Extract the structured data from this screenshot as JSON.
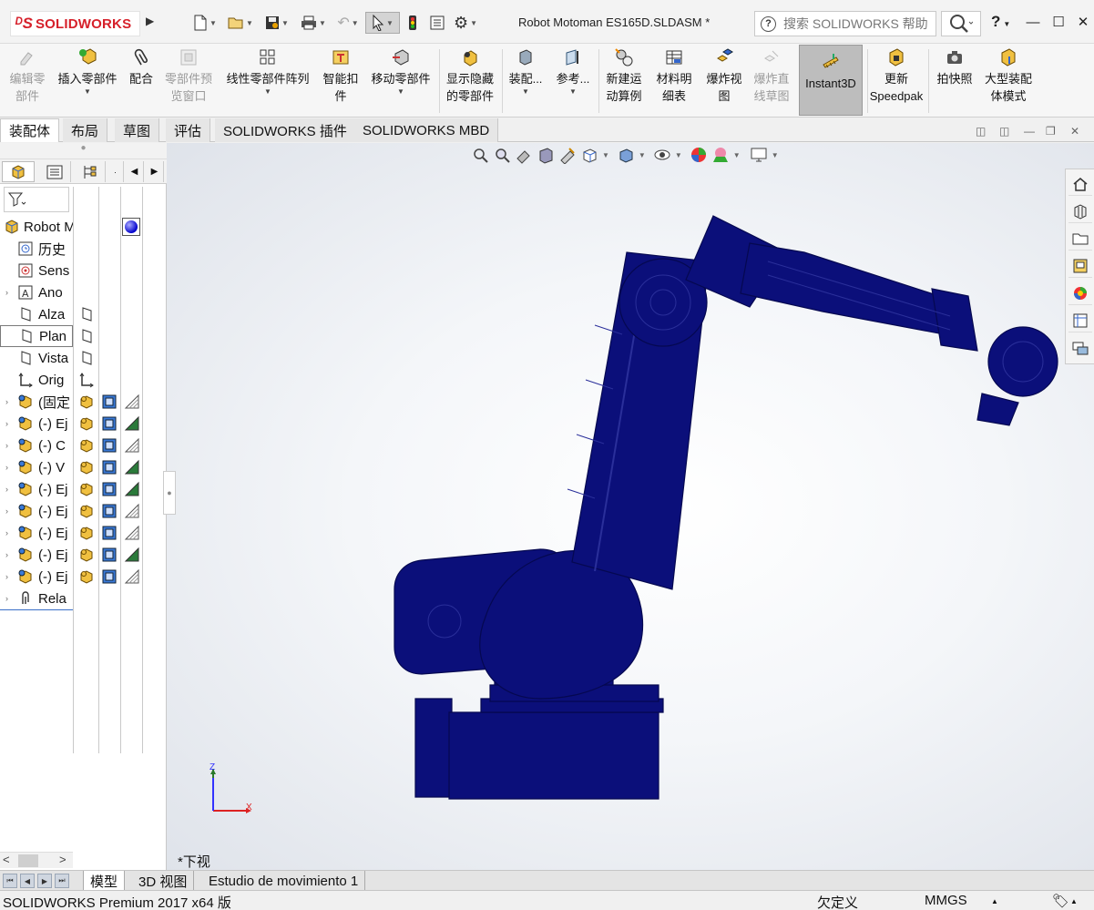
{
  "app": {
    "logo_text": "SOLIDWORKS",
    "document_title": "Robot Motoman ES165D.SLDASM *",
    "search_placeholder": "搜索 SOLIDWORKS 帮助",
    "help_label": "?"
  },
  "command_manager": {
    "items": [
      {
        "label": "编辑零\n部件",
        "enabled": false,
        "icon": "edit-component-icon"
      },
      {
        "label": "插入零部件",
        "enabled": true,
        "icon": "insert-components-icon",
        "dropdown": true
      },
      {
        "label": "配合",
        "enabled": true,
        "icon": "mate-icon"
      },
      {
        "label": "零部件预\n览窗口",
        "enabled": false,
        "icon": "component-preview-icon"
      },
      {
        "label": "线性零部件阵列",
        "enabled": true,
        "icon": "linear-pattern-icon",
        "dropdown": true
      },
      {
        "label": "智能扣\n件",
        "enabled": true,
        "icon": "smart-fasteners-icon"
      },
      {
        "label": "移动零部件",
        "enabled": true,
        "icon": "move-component-icon",
        "dropdown": true
      },
      {
        "label": "显示隐藏\n的零部件",
        "enabled": true,
        "icon": "show-hidden-icon"
      },
      {
        "label": "装配...",
        "enabled": true,
        "icon": "assembly-features-icon",
        "dropdown": true
      },
      {
        "label": "参考...",
        "enabled": true,
        "icon": "reference-geometry-icon",
        "dropdown": true
      },
      {
        "label": "新建运\n动算例",
        "enabled": true,
        "icon": "new-motion-study-icon"
      },
      {
        "label": "材料明\n细表",
        "enabled": true,
        "icon": "bom-icon"
      },
      {
        "label": "爆炸视\n图",
        "enabled": true,
        "icon": "exploded-view-icon"
      },
      {
        "label": "爆炸直\n线草图",
        "enabled": false,
        "icon": "explode-line-sketch-icon"
      },
      {
        "label": "Instant3D",
        "enabled": true,
        "icon": "instant3d-icon",
        "active": true
      },
      {
        "label": "更新\nSpeedpak",
        "enabled": true,
        "icon": "speedpak-icon"
      },
      {
        "label": "拍快照",
        "enabled": true,
        "icon": "snapshot-icon"
      },
      {
        "label": "大型装配\n体模式",
        "enabled": true,
        "icon": "large-assembly-icon"
      }
    ]
  },
  "tabs": [
    "装配体",
    "布局",
    "草图",
    "评估",
    "SOLIDWORKS 插件",
    "SOLIDWORKS MBD"
  ],
  "tree": {
    "root": "Robot M",
    "items": [
      {
        "label": "历史",
        "icon": "history-icon",
        "expand": false
      },
      {
        "label": "Sens",
        "icon": "sensors-icon",
        "expand": false
      },
      {
        "label": "Ano",
        "icon": "annotations-icon",
        "expand": true
      },
      {
        "label": "Alza",
        "icon": "plane-icon",
        "expand": false
      },
      {
        "label": "Plan",
        "icon": "plane-icon",
        "expand": false,
        "selected": true
      },
      {
        "label": "Vista",
        "icon": "plane-icon",
        "expand": false
      },
      {
        "label": "Orig",
        "icon": "origin-icon",
        "expand": false
      },
      {
        "label": "(固定",
        "icon": "part-icon",
        "expand": true
      },
      {
        "label": "(-) Ej",
        "icon": "part-icon",
        "expand": true
      },
      {
        "label": "(-) C",
        "icon": "part-icon",
        "expand": true
      },
      {
        "label": "(-) V",
        "icon": "part-icon",
        "expand": true
      },
      {
        "label": "(-) Ej",
        "icon": "part-icon",
        "expand": true
      },
      {
        "label": "(-) Ej",
        "icon": "part-icon",
        "expand": true
      },
      {
        "label": "(-) Ej",
        "icon": "part-icon",
        "expand": true
      },
      {
        "label": "(-) Ej",
        "icon": "part-icon",
        "expand": true
      },
      {
        "label": "(-) Ej",
        "icon": "part-icon",
        "expand": true
      },
      {
        "label": "Rela",
        "icon": "mates-icon",
        "expand": true
      }
    ]
  },
  "viewport": {
    "view_name": "*下视",
    "axis_z": "Z",
    "axis_x": "X",
    "model_color": "#0b0f7a"
  },
  "bottom_tabs": [
    "模型",
    "3D 视图",
    "Estudio de movimiento 1"
  ],
  "status": {
    "product": "SOLIDWORKS Premium 2017 x64 版",
    "definition": "欠定义",
    "units": "MMGS"
  }
}
